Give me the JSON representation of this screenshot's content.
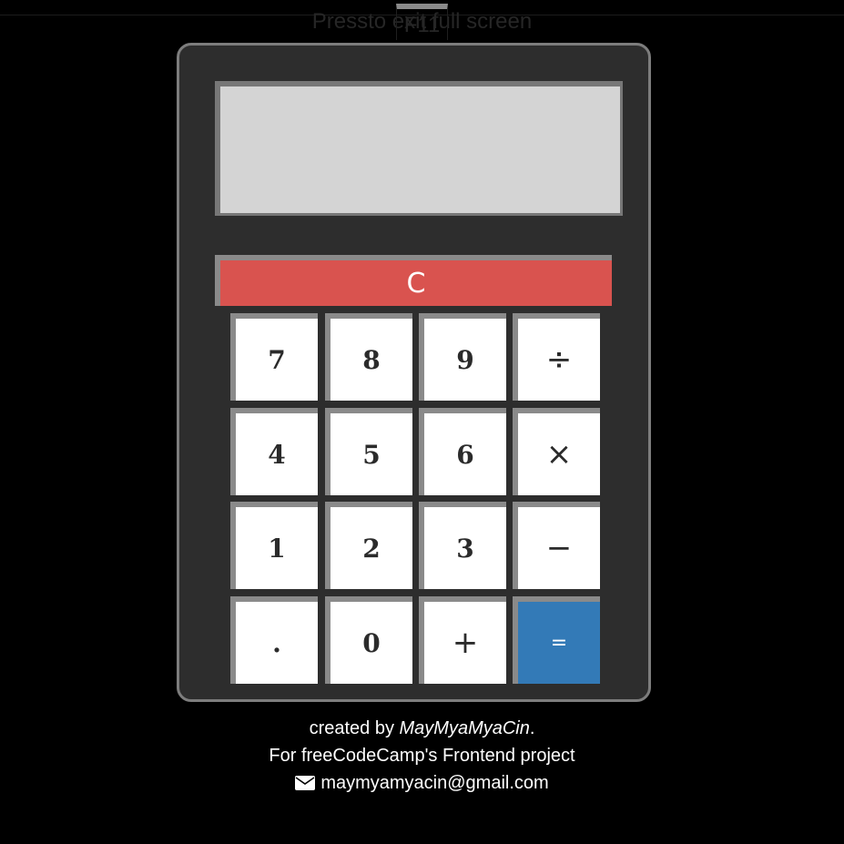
{
  "fullscreen_notice": {
    "before": "Press",
    "key": "F11",
    "after": "to exit full screen"
  },
  "display": {
    "value": ""
  },
  "keys": {
    "clear": "C",
    "row1": [
      "7",
      "8",
      "9",
      "÷"
    ],
    "row2": [
      "4",
      "5",
      "6",
      "×"
    ],
    "row3": [
      "1",
      "2",
      "3",
      "−"
    ],
    "row4": [
      ".",
      "0",
      "+",
      "="
    ]
  },
  "colors": {
    "clear_key": "#d9534f",
    "equals_key": "#337ab7",
    "number_key": "#ffffff",
    "display": "#d4d4d4",
    "body": "#2d2d2d"
  },
  "credits": {
    "created_by_prefix": "created by ",
    "author": "MayMyaMyaCin",
    "created_by_suffix": ".",
    "project_line": "For freeCodeCamp's Frontend project",
    "email_icon": "envelope-icon",
    "email": "maymyamyacin@gmail.com"
  }
}
